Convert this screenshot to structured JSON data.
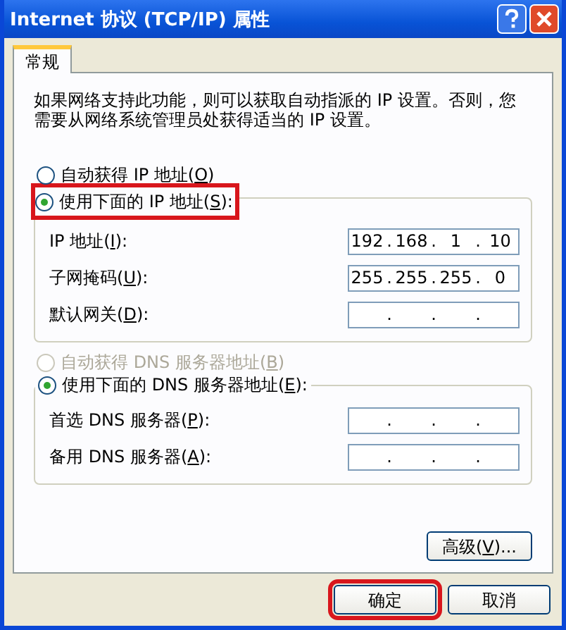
{
  "window": {
    "title": "Internet 协议 (TCP/IP) 属性"
  },
  "tabs": [
    {
      "label": "常规",
      "selected": true
    }
  ],
  "intro": "如果网络支持此功能，则可以获取自动指派的 IP 设置。否则，您需要从网络系统管理员处获得适当的 IP 设置。",
  "groups": [
    {
      "auto_option": {
        "text": "自动获得 IP 地址(",
        "accel": "O",
        "tail": ")",
        "selected": false,
        "disabled": false
      },
      "manual_option": {
        "text": "使用下面的 IP 地址(",
        "accel": "S",
        "tail": "):",
        "selected": true,
        "disabled": false,
        "highlighted": true
      },
      "fields": [
        {
          "text": "IP 地址(",
          "accel": "I",
          "tail": "):",
          "octets": [
            "192",
            "168",
            "1",
            "10"
          ],
          "separators": [
            ".",
            ".",
            "."
          ]
        },
        {
          "text": "子网掩码(",
          "accel": "U",
          "tail": "):",
          "octets": [
            "255",
            "255",
            "255",
            "0"
          ],
          "separators": [
            ".",
            ".",
            "."
          ]
        },
        {
          "text": "默认网关(",
          "accel": "D",
          "tail": "):",
          "separators": [
            ".",
            ".",
            "."
          ]
        }
      ]
    },
    {
      "auto_option": {
        "text": "自动获得 DNS 服务器地址(",
        "accel": "B",
        "tail": ")",
        "selected": false,
        "disabled": true
      },
      "manual_option": {
        "text": "使用下面的 DNS 服务器地址(",
        "accel": "E",
        "tail": "):",
        "selected": true,
        "disabled": false,
        "highlighted": false
      },
      "fields": [
        {
          "text": "首选 DNS 服务器(",
          "accel": "P",
          "tail": "):",
          "separators": [
            ".",
            ".",
            "."
          ]
        },
        {
          "text": "备用 DNS 服务器(",
          "accel": "A",
          "tail": "):",
          "separators": [
            ".",
            ".",
            "."
          ]
        }
      ]
    }
  ],
  "advanced_button": {
    "text": "高级(",
    "accel": "V",
    "tail": ")..."
  },
  "buttons": [
    {
      "text": "确定",
      "highlighted": true
    },
    {
      "text": "取消",
      "highlighted": false
    }
  ]
}
